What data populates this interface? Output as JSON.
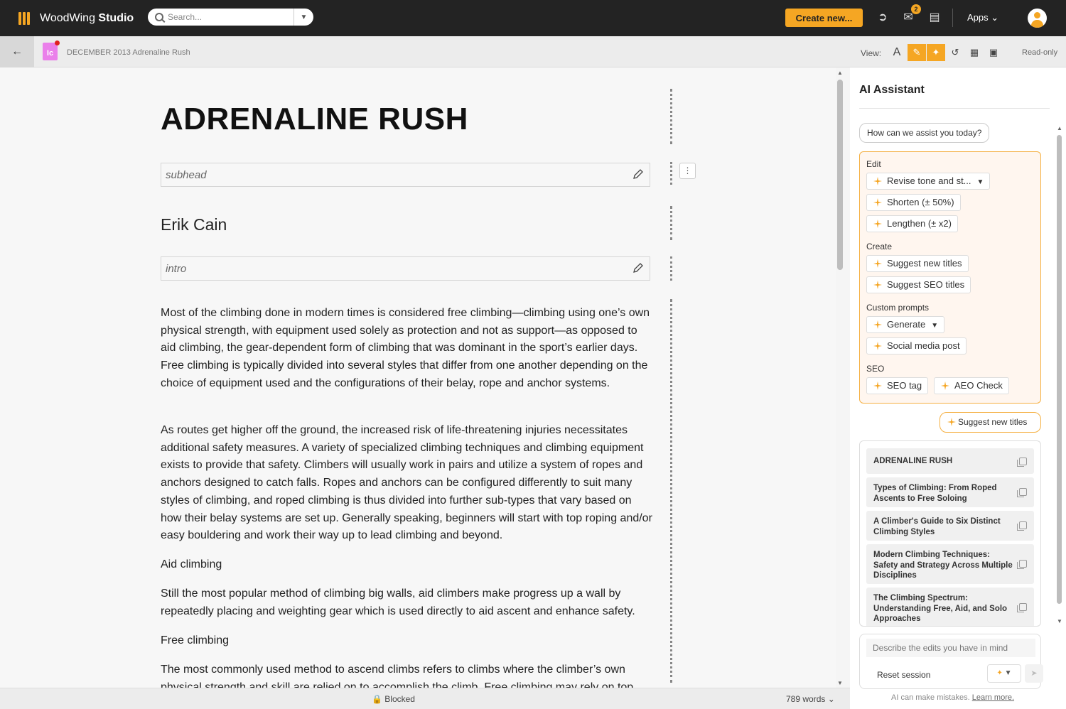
{
  "topbar": {
    "brand_light": "WoodWing",
    "brand_bold": "Studio",
    "search_placeholder": "Search...",
    "create_label": "Create new...",
    "inbox_count": "2",
    "apps_label": "Apps"
  },
  "subbar": {
    "doc_type": "Ic",
    "doc_title": "DECEMBER 2013 Adrenaline Rush",
    "view_label": "View:",
    "view_text_button": "A",
    "readonly_label": "Read-only"
  },
  "article": {
    "headline": "ADRENALINE RUSH",
    "subhead_placeholder": "subhead",
    "author": "Erik Cain",
    "intro_placeholder": "intro",
    "paragraphs": [
      "Most of the climbing done in modern times is considered free climbing—climbing using one’s own physical strength, with equipment used solely as protection and not as support—as opposed to aid climbing, the gear-dependent form of climbing that was dominant in the sport’s earlier days. Free climbing is typically divided into several styles that differ from one another depending on the choice of equipment used and the configurations of their belay, rope and anchor systems.",
      "As routes get higher off the ground, the increased risk of life-threatening injuries necessitates additional safety measures. A variety of specialized climbing techniques and climbing equipment exists to provide that safety. Climbers will usually work in pairs and utilize a system of ropes and anchors designed to catch falls. Ropes and anchors can be configured differently to suit many styles of climbing, and roped climbing is thus divided into further sub-types that vary based on how their belay systems are set up. Generally speaking, beginners will start with top roping and/or easy bouldering and work their way up to lead climbing and beyond.",
      "Aid climbing",
      "Still the most popular method of climbing big walls, aid climbers make progress up a wall by repeatedly placing and weighting gear which is used directly to aid ascent and enhance safety.",
      "Free climbing",
      "The most commonly used method to ascend climbs refers to climbs where the climber’s own physical strength and skill are relied on to accomplish the climb. Free climbing may rely on top"
    ]
  },
  "status": {
    "blocked_label": "Blocked",
    "word_count": "789 words"
  },
  "ai_panel": {
    "title": "AI Assistant",
    "greeting": "How can we assist you today?",
    "sections": {
      "edit": "Edit",
      "create": "Create",
      "custom": "Custom prompts",
      "seo": "SEO"
    },
    "actions": {
      "revise": "Revise tone and st...",
      "shorten": "Shorten (± 50%)",
      "lengthen": "Lengthen (± x2)",
      "suggest_titles": "Suggest new titles",
      "suggest_seo": "Suggest SEO titles",
      "generate": "Generate",
      "social": "Social media post",
      "seo_tag": "SEO tag",
      "aeo_check": "AEO Check"
    },
    "user_request": "Suggest new titles",
    "results": [
      "ADRENALINE RUSH",
      "Types of Climbing: From Roped Ascents to Free Soloing",
      "A Climber's Guide to Six Distinct Climbing Styles",
      "Modern Climbing Techniques: Safety and Strategy Across Multiple Disciplines",
      "The Climbing Spectrum: Understanding Free, Aid, and Solo Approaches"
    ],
    "input_placeholder": "Describe the edits you have in mind",
    "reset_label": "Reset session",
    "disclaimer": "AI can make mistakes.",
    "learn_more": "Learn more."
  },
  "colors": {
    "accent": "#f5a623",
    "topbar_bg": "#232323",
    "doc_icon": "#ea80ea"
  }
}
